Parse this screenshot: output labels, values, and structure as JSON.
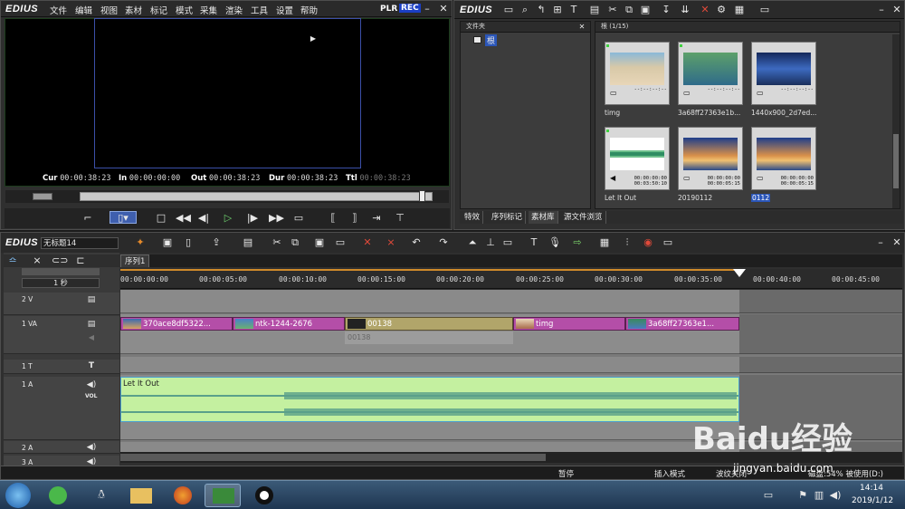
{
  "player": {
    "brand": "EDIUS",
    "menu": [
      "文件",
      "编辑",
      "视图",
      "素材",
      "标记",
      "模式",
      "采集",
      "渲染",
      "工具",
      "设置",
      "帮助"
    ],
    "plr_label": "PLR",
    "rec_label": "REC",
    "timecodes": {
      "cur_label": "Cur",
      "cur_value": "00:00:38:23",
      "in_label": "In",
      "in_value": "00:00:00:00",
      "out_label": "Out",
      "out_value": "00:00:38:23",
      "dur_label": "Dur",
      "dur_value": "00:00:38:23",
      "ttl_label": "Ttl",
      "ttl_value": "00:00:38:23"
    }
  },
  "bin": {
    "brand": "EDIUS",
    "folder_pane_title": "文件夹",
    "root_folder": "根",
    "clip_pane_title": "根 (1/15)",
    "clips": [
      {
        "name": "timg",
        "duration": "--:--:--:--",
        "kind": "still",
        "color": "#e7d6b8"
      },
      {
        "name": "3a68ff27363e1b...",
        "duration": "--:--:--:--",
        "kind": "still",
        "color": "#4a8a5c"
      },
      {
        "name": "1440x900_2d7ed...",
        "duration": "--:--:--:--",
        "kind": "still",
        "color": "#2b4a8c"
      },
      {
        "name": "Let It Out",
        "duration": "00:00:00:00\n00:03:50:10",
        "kind": "audio",
        "color": "#cfe8c8"
      },
      {
        "name": "20190112",
        "duration": "00:00:00:00\n00:00:05:15",
        "kind": "video",
        "color": "#d88a4a"
      },
      {
        "name": "0112",
        "duration": "00:00:00:00\n00:00:05:15",
        "kind": "video",
        "color": "#d88a4a"
      }
    ],
    "tabs": [
      "特效",
      "序列标记",
      "素材库",
      "源文件浏览"
    ]
  },
  "timeline": {
    "brand": "EDIUS",
    "project_name": "无标题14",
    "sequence_tab": "序列1",
    "zoom_label": "1 秒",
    "ruler": [
      "00:00:00:00",
      "00:00:05:00",
      "00:00:10:00",
      "00:00:15:00",
      "00:00:20:00",
      "00:00:25:00",
      "00:00:30:00",
      "00:00:35:00",
      "00:00:40:00",
      "00:00:45:00"
    ],
    "tracks": [
      {
        "name": "2 V"
      },
      {
        "name": "1 VA"
      },
      {
        "name": "1 T"
      },
      {
        "name": "1 A",
        "vol": "VOL"
      },
      {
        "name": "2 A"
      },
      {
        "name": "3 A"
      }
    ],
    "video_clips": [
      "370ace8df5322...",
      "ntk-1244-2676",
      "00138",
      "timg",
      "3a68ff27363e1..."
    ],
    "ghost_clip": "00138",
    "audio_clip": "Let It Out",
    "status": {
      "pause": "暂停",
      "insert_mode": "插入模式",
      "ripple": "波纹关闭",
      "disk": "磁盘:54% 被使用(D:)"
    }
  },
  "taskbar": {
    "time": "14:14",
    "date": "2019/1/12"
  },
  "watermark": {
    "brand": "Baidu经验",
    "url": "jingyan.baidu.com"
  }
}
